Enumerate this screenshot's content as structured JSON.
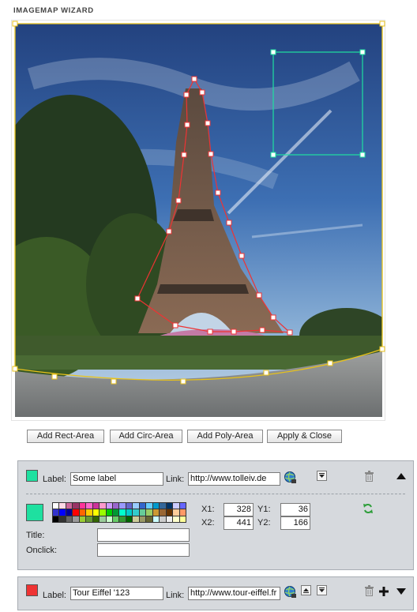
{
  "header": {
    "title": "IMAGEMAP WIZARD"
  },
  "toolbar": {
    "add_rect": "Add Rect-Area",
    "add_circ": "Add Circ-Area",
    "add_poly": "Add Poly-Area",
    "apply_close": "Apply & Close"
  },
  "areas": [
    {
      "color": "#1ee0a0",
      "label_caption": "Label:",
      "label_value": "Some label",
      "link_caption": "Link:",
      "link_value": "http://www.tolleiv.de",
      "title_caption": "Title:",
      "title_value": "",
      "onclick_caption": "Onclick:",
      "onclick_value": "",
      "x1_caption": "X1:",
      "x1": "328",
      "y1_caption": "Y1:",
      "y1": "36",
      "x2_caption": "X2:",
      "x2": "441",
      "y2_caption": "Y2:",
      "y2": "166"
    },
    {
      "color": "#ee3333",
      "label_caption": "Label:",
      "label_value": "Tour Eiffel '123",
      "link_caption": "Link:",
      "link_value": "http://www.tour-eiffel.fr"
    }
  ],
  "colors": {
    "accent_yellow": "#e8c21a",
    "rect_area": "#1ee0a0",
    "poly_area": "#ee3333",
    "panel_bg": "#d6d9dd"
  },
  "icons": {
    "link_browser": "globe-icon",
    "down": "arrow-down-icon",
    "up": "arrow-up-icon",
    "delete": "trash-icon",
    "collapse": "triangle-up-icon",
    "expand": "triangle-down-icon",
    "add": "plus-icon",
    "refresh": "refresh-icon"
  }
}
